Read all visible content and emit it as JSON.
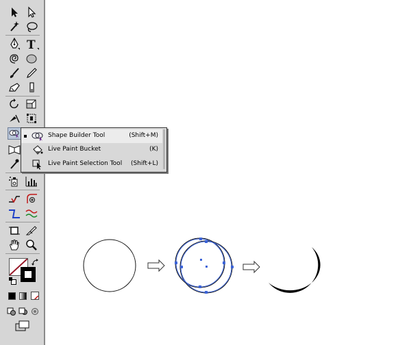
{
  "tools_panel": {
    "tools": [
      {
        "id": "selection",
        "icon": "selection-arrow-icon"
      },
      {
        "id": "direct-selection",
        "icon": "direct-selection-arrow-icon"
      },
      {
        "id": "magic-wand",
        "icon": "magic-wand-icon"
      },
      {
        "id": "lasso",
        "icon": "lasso-icon"
      },
      {
        "id": "pen",
        "icon": "pen-icon"
      },
      {
        "id": "type",
        "icon": "type-icon",
        "glyph": "T"
      },
      {
        "id": "spiral",
        "icon": "spiral-icon"
      },
      {
        "id": "ellipse",
        "icon": "ellipse-icon"
      },
      {
        "id": "paintbrush",
        "icon": "paintbrush-icon"
      },
      {
        "id": "pencil",
        "icon": "pencil-icon"
      },
      {
        "id": "blob-brush",
        "icon": "blob-brush-icon"
      },
      {
        "id": "eraser",
        "icon": "eraser-icon"
      },
      {
        "id": "rotate",
        "icon": "rotate-icon"
      },
      {
        "id": "scale",
        "icon": "scale-icon"
      },
      {
        "id": "width",
        "icon": "width-tool-icon"
      },
      {
        "id": "free-transform",
        "icon": "free-transform-icon"
      },
      {
        "id": "shape-builder",
        "icon": "shape-builder-icon"
      },
      {
        "id": "perspective-grid",
        "icon": "perspective-grid-icon"
      },
      {
        "id": "eyedropper",
        "icon": "eyedropper-icon"
      },
      {
        "id": "symbol-sprayer",
        "icon": "symbol-sprayer-icon"
      },
      {
        "id": "column-graph",
        "icon": "column-graph-icon"
      },
      {
        "id": "corner-1",
        "icon": "corner-path-icon"
      },
      {
        "id": "corner-2",
        "icon": "corner-add-point-icon"
      },
      {
        "id": "path-1",
        "icon": "blue-path-icon"
      },
      {
        "id": "path-2",
        "icon": "wave-path-icon"
      },
      {
        "id": "artboard",
        "icon": "artboard-icon"
      },
      {
        "id": "slice",
        "icon": "slice-icon"
      },
      {
        "id": "hand",
        "icon": "hand-icon"
      },
      {
        "id": "zoom",
        "icon": "zoom-icon"
      }
    ]
  },
  "flyout": {
    "items": [
      {
        "label": "Shape Builder Tool",
        "shortcut": "(Shift+M)",
        "icon": "shape-builder-icon",
        "current": true
      },
      {
        "label": "Live Paint Bucket",
        "shortcut": "(K)",
        "icon": "live-paint-bucket-icon",
        "current": false
      },
      {
        "label": "Live Paint Selection Tool",
        "shortcut": "(Shift+L)",
        "icon": "live-paint-selection-icon",
        "current": false
      }
    ]
  },
  "colors": {
    "toolbar_bg": "#d6d6d6",
    "selection_blue": "#3c64d8",
    "fill_icon_stroke": "#9a1a2a",
    "crescent": "#000000"
  },
  "illustration": {
    "steps": [
      "single-circle",
      "two-overlapping-circles-selected",
      "crescent-result"
    ]
  }
}
